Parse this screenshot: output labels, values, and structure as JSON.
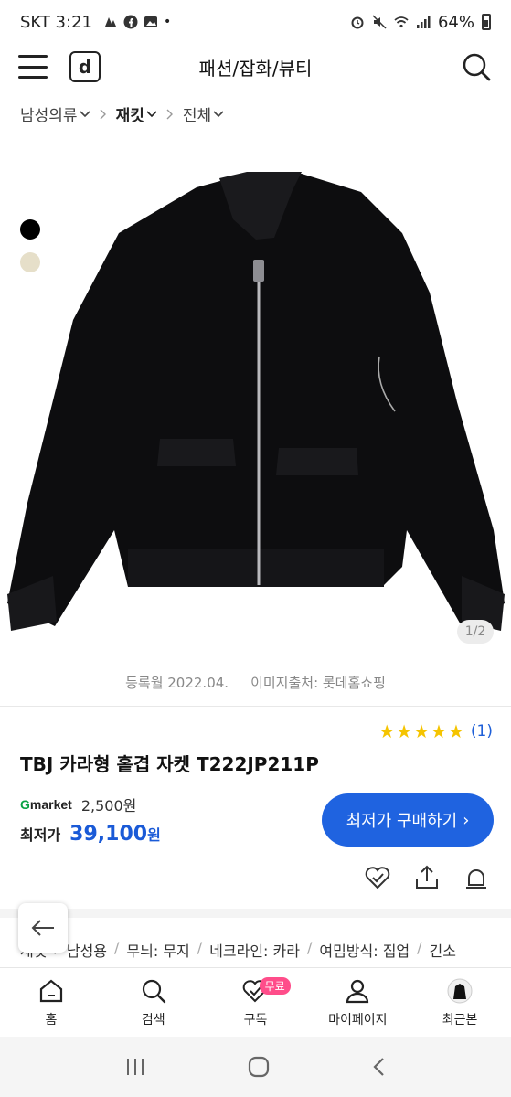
{
  "status_bar": {
    "carrier_time": "SKT 3:21",
    "battery": "64%"
  },
  "header": {
    "logo_letter": "d",
    "title": "패션/잡화/뷰티"
  },
  "breadcrumb": [
    {
      "label": "남성의류"
    },
    {
      "label": "재킷"
    },
    {
      "label": "전체"
    }
  ],
  "product": {
    "image_page": "1/2",
    "swatches": [
      "#000000",
      "#e6dfc9"
    ],
    "registered": "등록월 2022.04.",
    "image_source": "이미지출처: 롯데홈쇼핑",
    "stars": "★★★★★",
    "review_count": "(1)",
    "title": "TBJ 카라형 홑겹 자켓 T222JP211P",
    "seller_logo_g": "G",
    "seller_logo_rest": "market",
    "shipping": "2,500원",
    "price_label": "최저가",
    "price": "39,100",
    "price_unit": "원",
    "buy_label": "최저가 구매하기",
    "buy_arrow": "›"
  },
  "tags": [
    "재킷",
    "남성용",
    "무늬: 무지",
    "네크라인: 카라",
    "여밈방식: 집업",
    "긴소"
  ],
  "bottom_nav": [
    {
      "label": "홈",
      "icon": "home-icon"
    },
    {
      "label": "검색",
      "icon": "search-icon"
    },
    {
      "label": "구독",
      "icon": "heart-check-icon",
      "badge": "무료"
    },
    {
      "label": "마이페이지",
      "icon": "person-icon"
    },
    {
      "label": "최근본",
      "icon": "recent-jacket-icon"
    }
  ],
  "colors": {
    "accent": "#1f63e0",
    "price": "#1a5ad7",
    "star": "#f5c400",
    "badge": "#ff4d8a"
  }
}
